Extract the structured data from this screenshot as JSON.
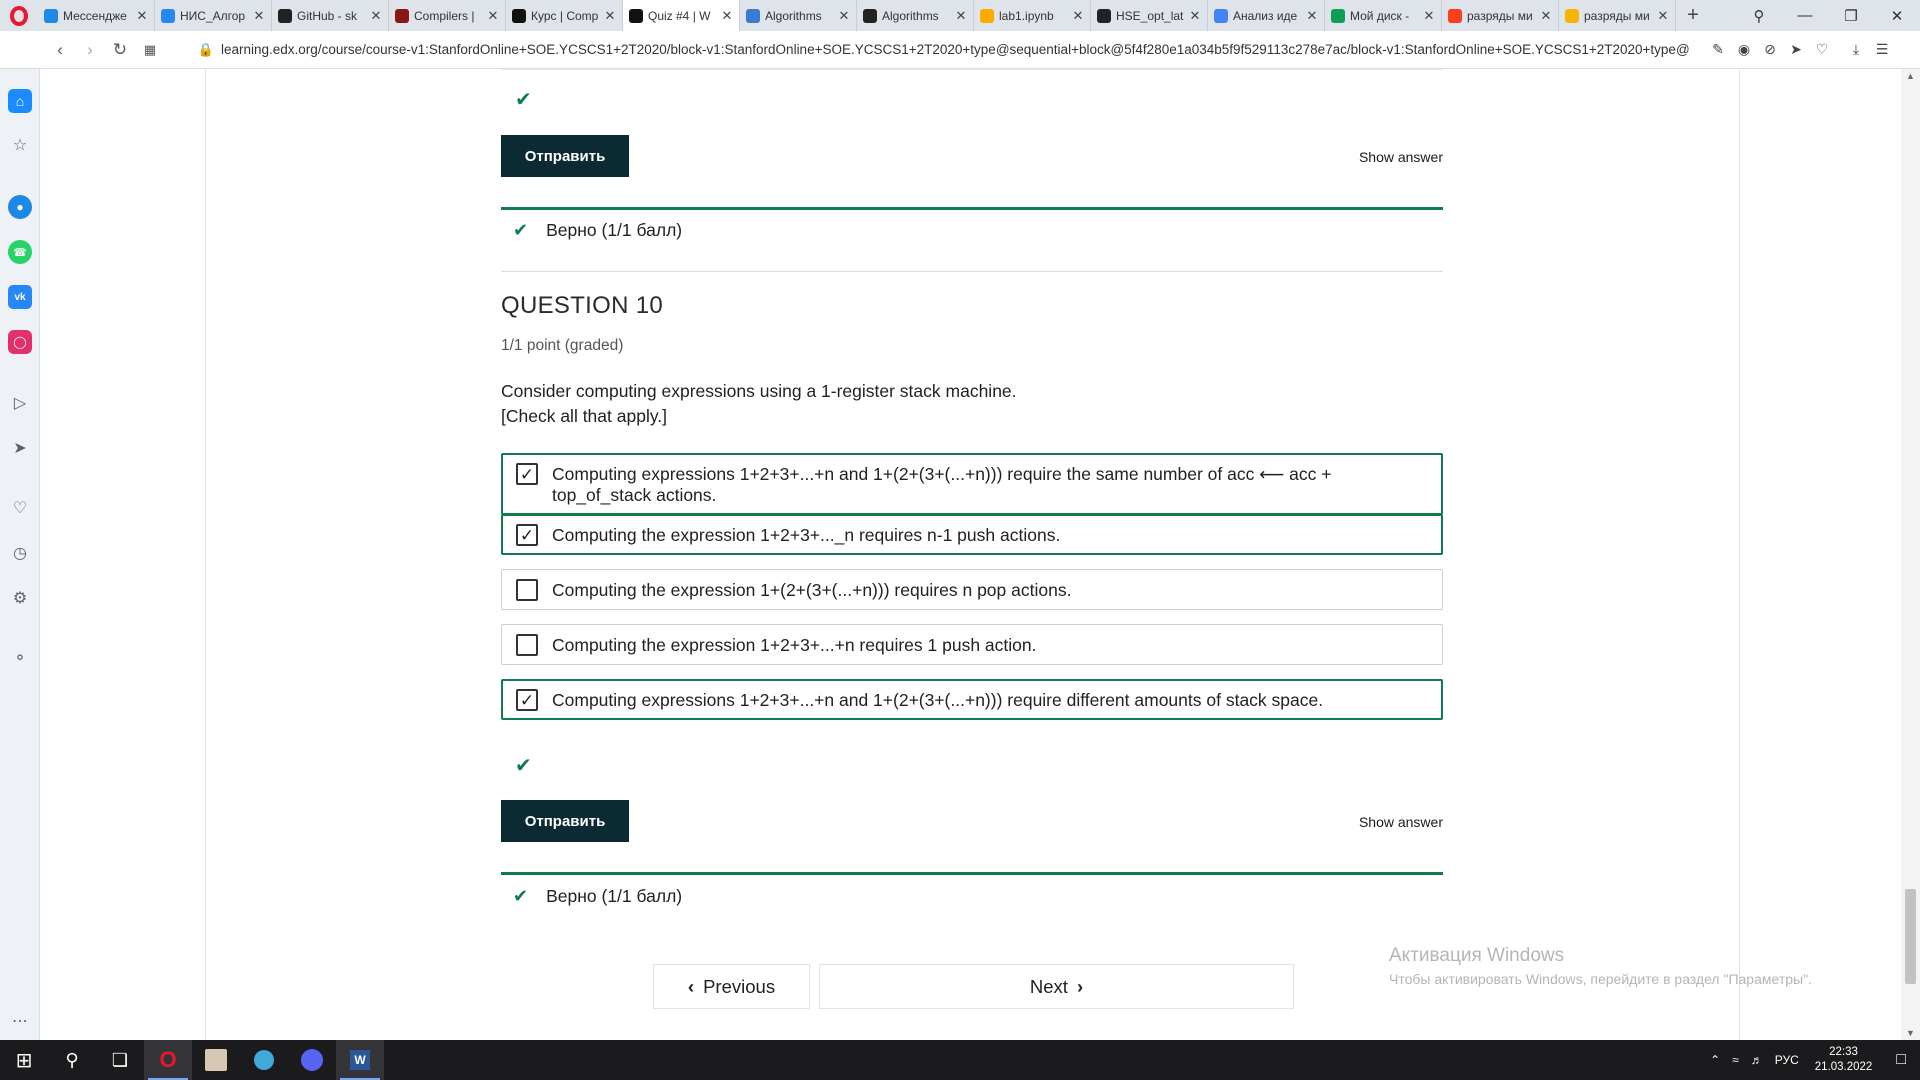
{
  "browser": {
    "tabs": [
      {
        "title": "Мессендже",
        "icon": "messenger-icon",
        "color": "#1e88e5",
        "active": false
      },
      {
        "title": "НИС_Алгор",
        "icon": "vk-icon",
        "color": "#2787f5",
        "active": false
      },
      {
        "title": "GitHub - sk",
        "icon": "github-icon",
        "color": "#222222",
        "active": false
      },
      {
        "title": "Compilers |",
        "icon": "stanford-icon",
        "color": "#8c1515",
        "active": false
      },
      {
        "title": "Курс | Comp",
        "icon": "edx-icon",
        "color": "#111111",
        "active": false
      },
      {
        "title": "Quiz #4 | W",
        "icon": "edx-icon",
        "color": "#111111",
        "active": true
      },
      {
        "title": "Algorithms",
        "icon": "algorithms-icon",
        "color": "#3a7bd5",
        "active": false
      },
      {
        "title": "Algorithms",
        "icon": "github-icon",
        "color": "#222222",
        "active": false
      },
      {
        "title": "lab1.ipynb",
        "icon": "colab-icon",
        "color": "#f9ab00",
        "active": false
      },
      {
        "title": "HSE_opt_lat",
        "icon": "github-icon",
        "color": "#222222",
        "active": false
      },
      {
        "title": "Анализ иде",
        "icon": "chrome-icon",
        "color": "#4285f4",
        "active": false
      },
      {
        "title": "Мой диск -",
        "icon": "drive-icon",
        "color": "#0f9d58",
        "active": false
      },
      {
        "title": "разряды ми",
        "icon": "yandex-icon",
        "color": "#fc3f1d",
        "active": false
      },
      {
        "title": "разряды ми",
        "icon": "image-icon",
        "color": "#f5b400",
        "active": false
      }
    ],
    "url": "learning.edx.org/course/course-v1:StanfordOnline+SOE.YCSCS1+2T2020/block-v1:StanfordOnline+SOE.YCSCS1+2T2020+type@sequential+block@5f4f280e1a034b5f9f529113c278e7ac/block-v1:StanfordOnline+SOE.YCSCS1+2T2020+type@"
  },
  "prev_question": {
    "submit_label": "Отправить",
    "show_answer_label": "Show answer",
    "status_text": "Верно (1/1 балл)"
  },
  "question": {
    "title": "QUESTION 10",
    "points": "1/1 point (graded)",
    "prompt_line1": "Consider computing expressions using a 1-register stack machine.",
    "prompt_line2": "[Check all that apply.]",
    "options": [
      {
        "text": "Computing expressions 1+2+3+...+n and 1+(2+(3+(...+n))) require the same number of acc ⟵ acc + top_of_stack actions.",
        "checked": true
      },
      {
        "text": "Computing the expression 1+2+3+..._n requires n-1 push actions.",
        "checked": true
      },
      {
        "text": "Computing the expression 1+(2+(3+(...+n))) requires n pop actions.",
        "checked": false
      },
      {
        "text": "Computing the expression 1+2+3+...+n requires 1 push action.",
        "checked": false
      },
      {
        "text": "Computing expressions 1+2+3+...+n and 1+(2+(3+(...+n))) require different amounts of stack space.",
        "checked": true
      }
    ],
    "submit_label": "Отправить",
    "show_answer_label": "Show answer",
    "status_text": "Верно (1/1 балл)"
  },
  "pagination": {
    "previous_label": "Previous",
    "next_label": "Next"
  },
  "watermark": {
    "line1": "Активация Windows",
    "line2": "Чтобы активировать Windows, перейдите в раздел \"Параметры\"."
  },
  "taskbar": {
    "language": "РУС",
    "time": "22:33",
    "date": "21.03.2022"
  },
  "colors": {
    "accent_green": "#0d7d4d",
    "button_dark": "#0b2a32"
  }
}
